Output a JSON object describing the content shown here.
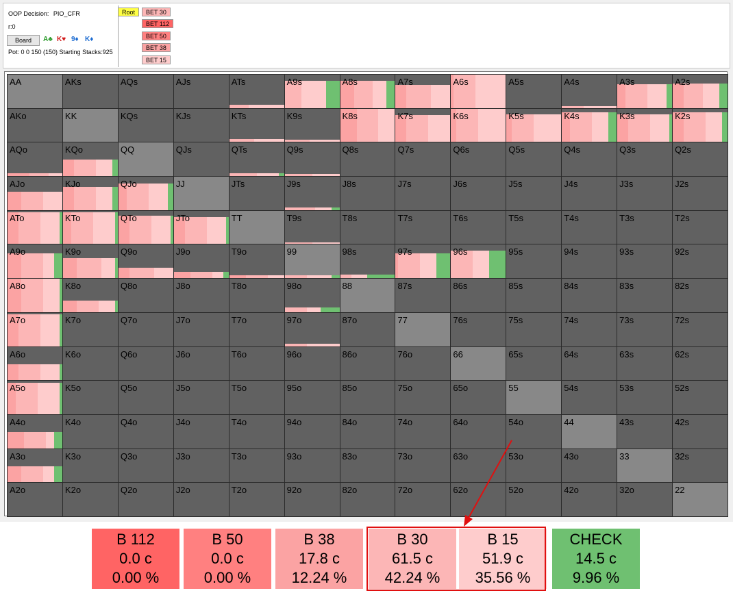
{
  "header": {
    "decision_label": "OOP Decision:",
    "decision_value": "PIO_CFR",
    "r_label": "r:0",
    "board_button": "Board",
    "pot_text": "Pot: 0 0 150 (150) Starting Stacks:925",
    "cards": [
      {
        "text": "A♣",
        "color": "#2a9a2a"
      },
      {
        "text": "K♥",
        "color": "#d11a1a"
      },
      {
        "text": "9♦",
        "color": "#1a6ad1"
      },
      {
        "text": "K♦",
        "color": "#1a6ad1"
      }
    ]
  },
  "tree": {
    "root": "Root",
    "nodes": [
      "BET 30",
      "BET 112",
      "BET 50",
      "BET 38",
      "BET 15"
    ]
  },
  "colors": {
    "b112": "#ff6464",
    "b50": "#ff8080",
    "b38": "#fba3a3",
    "b30": "#fcb6b6",
    "b15": "#fecccc",
    "check": "#6fc071",
    "root_node": "#ffff44"
  },
  "grid": {
    "ranks": [
      "A",
      "K",
      "Q",
      "J",
      "T",
      "9",
      "8",
      "7",
      "6",
      "5",
      "4",
      "3",
      "2"
    ],
    "strategy_segment_order": [
      "b112",
      "b50",
      "b38",
      "b30",
      "b15",
      "check"
    ],
    "strategies": {
      "A9s": [
        0,
        0,
        0,
        0.3,
        0.45,
        0.25
      ],
      "A8s": [
        0,
        0,
        0.25,
        0.35,
        0.25,
        0.15
      ],
      "A7s": [
        0,
        0,
        0.2,
        0.45,
        0.35,
        0
      ],
      "A6s": [
        0,
        0,
        0.05,
        0.4,
        0.55,
        0
      ],
      "A3s": [
        0,
        0,
        0.15,
        0.4,
        0.35,
        0.1
      ],
      "A2s": [
        0,
        0,
        0.2,
        0.35,
        0.3,
        0.15
      ],
      "ATs": [
        0,
        0,
        0,
        0.35,
        0.65,
        0
      ],
      "A4s": [
        0,
        0,
        0,
        0.4,
        0.6,
        0
      ],
      "K8s": [
        0,
        0,
        0.3,
        0.4,
        0.3,
        0
      ],
      "K7s": [
        0,
        0,
        0.2,
        0.4,
        0.4,
        0
      ],
      "K6s": [
        0,
        0,
        0.1,
        0.4,
        0.5,
        0
      ],
      "K5s": [
        0,
        0,
        0.1,
        0.4,
        0.5,
        0
      ],
      "K4s": [
        0,
        0,
        0.15,
        0.4,
        0.3,
        0.15
      ],
      "K3s": [
        0,
        0,
        0.2,
        0.4,
        0.35,
        0.05
      ],
      "K2s": [
        0,
        0,
        0.2,
        0.4,
        0.3,
        0.1
      ],
      "KTs": [
        0,
        0,
        0,
        0.45,
        0.55,
        0
      ],
      "K9s": [
        0,
        0,
        0,
        0.45,
        0.55,
        0
      ],
      "KQo": [
        0,
        0,
        0.2,
        0.4,
        0.3,
        0.1
      ],
      "AQo": [
        0,
        0,
        0.4,
        0.35,
        0.25,
        0
      ],
      "QTs": [
        0,
        0,
        0,
        0.5,
        0.4,
        0.1
      ],
      "Q9s": [
        0,
        0,
        0,
        0.5,
        0.5,
        0
      ],
      "AJo": [
        0,
        0,
        0.25,
        0.4,
        0.35,
        0
      ],
      "KJo": [
        0,
        0,
        0.2,
        0.4,
        0.3,
        0.1
      ],
      "QJo": [
        0,
        0,
        0.15,
        0.4,
        0.35,
        0.1
      ],
      "J9s": [
        0,
        0,
        0,
        0.55,
        0.3,
        0.15
      ],
      "ATo": [
        0,
        0,
        0.2,
        0.4,
        0.35,
        0.05
      ],
      "KTo": [
        0,
        0,
        0.15,
        0.4,
        0.4,
        0.05
      ],
      "QTo": [
        0,
        0,
        0.2,
        0.4,
        0.35,
        0.05
      ],
      "JTo": [
        0,
        0,
        0.2,
        0.4,
        0.35,
        0.05
      ],
      "T9s": [
        0,
        0,
        0,
        0.5,
        0.5,
        0
      ],
      "A9o": [
        0,
        0,
        0.25,
        0.4,
        0.2,
        0.15
      ],
      "K9o": [
        0,
        0,
        0.25,
        0.45,
        0.25,
        0.05
      ],
      "Q9o": [
        0,
        0,
        0.2,
        0.45,
        0.35,
        0
      ],
      "J9o": [
        0,
        0,
        0.3,
        0.4,
        0.2,
        0.1
      ],
      "T9o": [
        0,
        0,
        0.3,
        0.4,
        0.3,
        0
      ],
      "99": [
        0,
        0,
        0,
        0.4,
        0.45,
        0.15
      ],
      "98s": [
        0,
        0,
        0,
        0.2,
        0.3,
        0.5
      ],
      "97s": [
        0,
        0,
        0.05,
        0.4,
        0.3,
        0.25
      ],
      "96s": [
        0,
        0,
        0,
        0.4,
        0.3,
        0.3
      ],
      "A8o": [
        0,
        0,
        0.25,
        0.4,
        0.3,
        0.05
      ],
      "K8o": [
        0,
        0,
        0.25,
        0.4,
        0.3,
        0.05
      ],
      "98o": [
        0,
        0,
        0,
        0.4,
        0.25,
        0.35
      ],
      "A7o": [
        0,
        0,
        0.2,
        0.4,
        0.35,
        0.05
      ],
      "97o": [
        0,
        0,
        0,
        0.4,
        0.6,
        0
      ],
      "A6o": [
        0,
        0,
        0.2,
        0.4,
        0.35,
        0.05
      ],
      "A5o": [
        0,
        0,
        0.15,
        0.4,
        0.4,
        0.05
      ],
      "A4o": [
        0,
        0,
        0.3,
        0.4,
        0.15,
        0.15
      ],
      "A3o": [
        0,
        0,
        0.25,
        0.4,
        0.2,
        0.15
      ]
    },
    "strategy_fill_heights": {
      "A9s": 0.82,
      "A8s": 0.82,
      "A7s": 0.7,
      "A6s": 1.0,
      "A3s": 0.72,
      "A2s": 0.74,
      "ATs": 0.1,
      "A4s": 0.06,
      "K8s": 1.0,
      "K7s": 0.8,
      "K6s": 1.0,
      "K5s": 0.82,
      "K4s": 0.9,
      "K3s": 0.82,
      "K2s": 0.9,
      "KTs": 0.1,
      "K9s": 0.06,
      "KQo": 0.5,
      "AQo": 0.08,
      "QTs": 0.08,
      "Q9s": 0.06,
      "AJo": 0.55,
      "KJo": 0.7,
      "QJo": 0.8,
      "J9s": 0.08,
      "ATo": 0.95,
      "KTo": 0.95,
      "QTo": 0.85,
      "JTo": 0.82,
      "T9s": 0.05,
      "A9o": 0.75,
      "K9o": 0.6,
      "Q9o": 0.32,
      "J9o": 0.18,
      "T9o": 0.08,
      "99": 0.08,
      "98s": 0.1,
      "97s": 0.75,
      "96s": 0.82,
      "A8o": 1.0,
      "K8o": 0.35,
      "98o": 0.15,
      "A7o": 0.95,
      "97o": 0.08,
      "A6o": 0.48,
      "A5o": 0.95,
      "A4o": 0.48,
      "A3o": 0.48
    }
  },
  "legend": [
    {
      "key": "b112",
      "name": "B 112",
      "chips": "0.0 c",
      "pct": "0.00 %"
    },
    {
      "key": "b50",
      "name": "B 50",
      "chips": "0.0 c",
      "pct": "0.00 %"
    },
    {
      "key": "b38",
      "name": "B 38",
      "chips": "17.8 c",
      "pct": "12.24 %"
    },
    {
      "key": "b30",
      "name": "B 30",
      "chips": "61.5 c",
      "pct": "42.24 %"
    },
    {
      "key": "b15",
      "name": "B 15",
      "chips": "51.9 c",
      "pct": "35.56 %"
    },
    {
      "key": "check",
      "name": "CHECK",
      "chips": "14.5 c",
      "pct": "9.96 %"
    }
  ]
}
